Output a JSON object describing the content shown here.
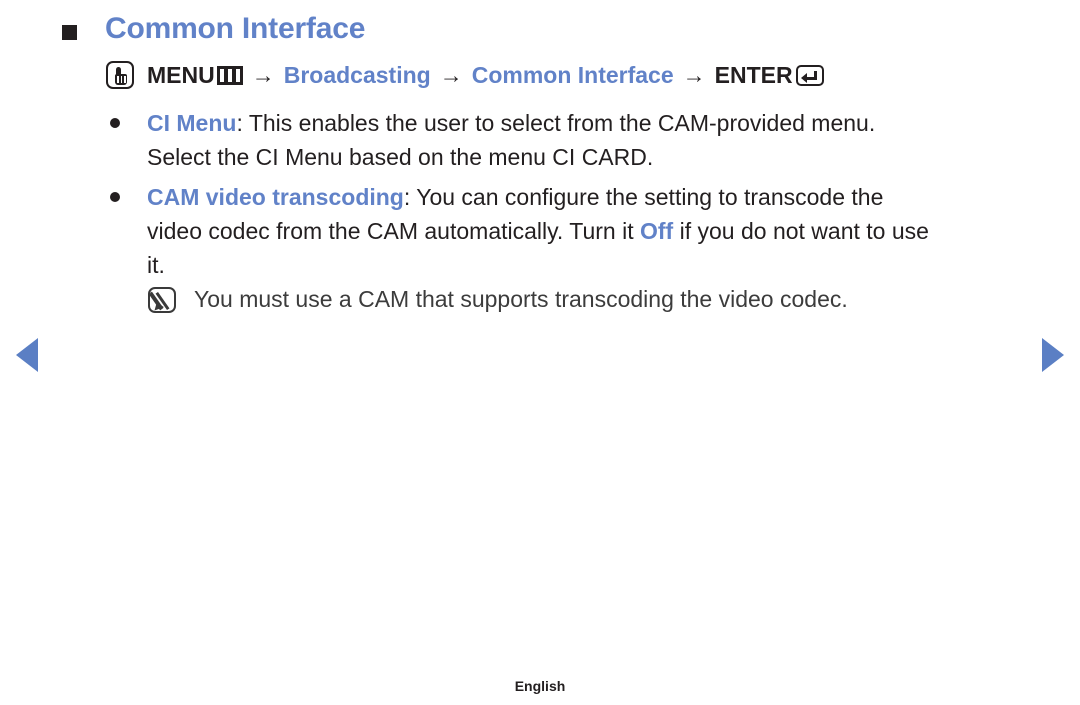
{
  "page": {
    "title": "Common Interface",
    "accent_color": "#6182c8",
    "text_color": "#231f20"
  },
  "menu_path": {
    "menu_icon": "hand-press-icon",
    "menu_label": "MENU",
    "menu_grid_icon": "menu-grid-icon",
    "arrow": "→",
    "item1": "Broadcasting",
    "item2": "Common Interface",
    "enter_label": "ENTER",
    "enter_icon": "enter-key-icon"
  },
  "bullets": [
    {
      "keyword": "CI Menu",
      "after_keyword": ": This enables the user to select from the CAM-provided menu.",
      "line2": "Select the CI Menu based on the menu CI CARD."
    },
    {
      "keyword": "CAM video transcoding",
      "part1": ": You can configure the setting to transcode the",
      "part2": "video codec from the CAM automatically. Turn it ",
      "inline_keyword": "Off",
      "part3": " if you do not want to use",
      "part4": "it."
    }
  ],
  "note": {
    "icon": "note-pencil-icon",
    "text": "You must use a CAM that supports transcoding the video codec."
  },
  "nav": {
    "prev_icon": "arrow-left-icon",
    "next_icon": "arrow-right-icon"
  },
  "footer": {
    "language": "English"
  }
}
